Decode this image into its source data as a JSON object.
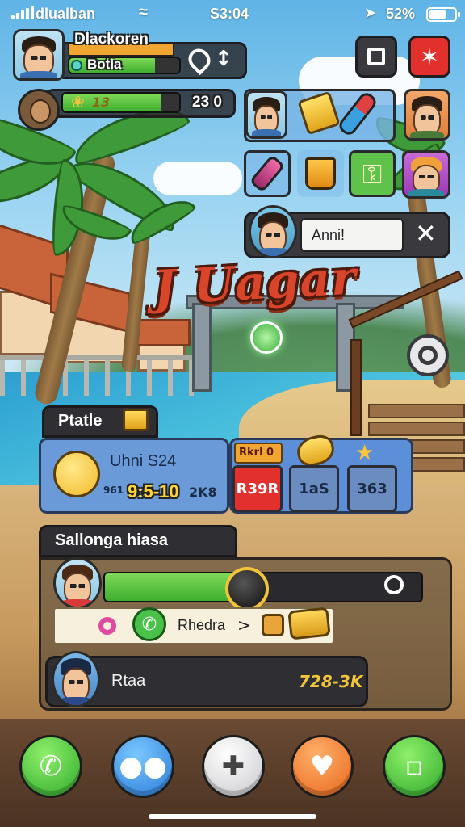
{
  "status_bar": {
    "carrier": "dlualban",
    "time": "S3:04",
    "battery": "52%"
  },
  "player": {
    "name": "Dlackoren",
    "rank": "Botia",
    "hp_fill": 0.78
  },
  "opponent": {
    "progress_label": "13",
    "score": "23 0",
    "xp_fill": 0.85
  },
  "top_buttons": {
    "close_icon": "x-icon",
    "pause_icon": "pause-icon",
    "chat_bubble_text": "Anni!"
  },
  "title": "J Uagar",
  "stats_panel": {
    "header": "Ptatle",
    "label": "Uhni S24",
    "value_small": "961",
    "value_main": "9:5-10",
    "value_unit": "2K8",
    "badge": "Rkrl 0",
    "cells": [
      "R39R",
      "1aS",
      "363"
    ]
  },
  "bottom_panel": {
    "header": "Sallonga hiasa",
    "slider_fill": 0.45,
    "row1_label": "Rhedra",
    "row1_arrow": ">",
    "row2_name": "Rtaa",
    "row2_value": "728-3K"
  },
  "colors": {
    "accent_green": "#3fae2f",
    "panel_dark": "#2c2c30",
    "red_button": "#e2312d",
    "blue_panel": "#5c8fd8"
  }
}
